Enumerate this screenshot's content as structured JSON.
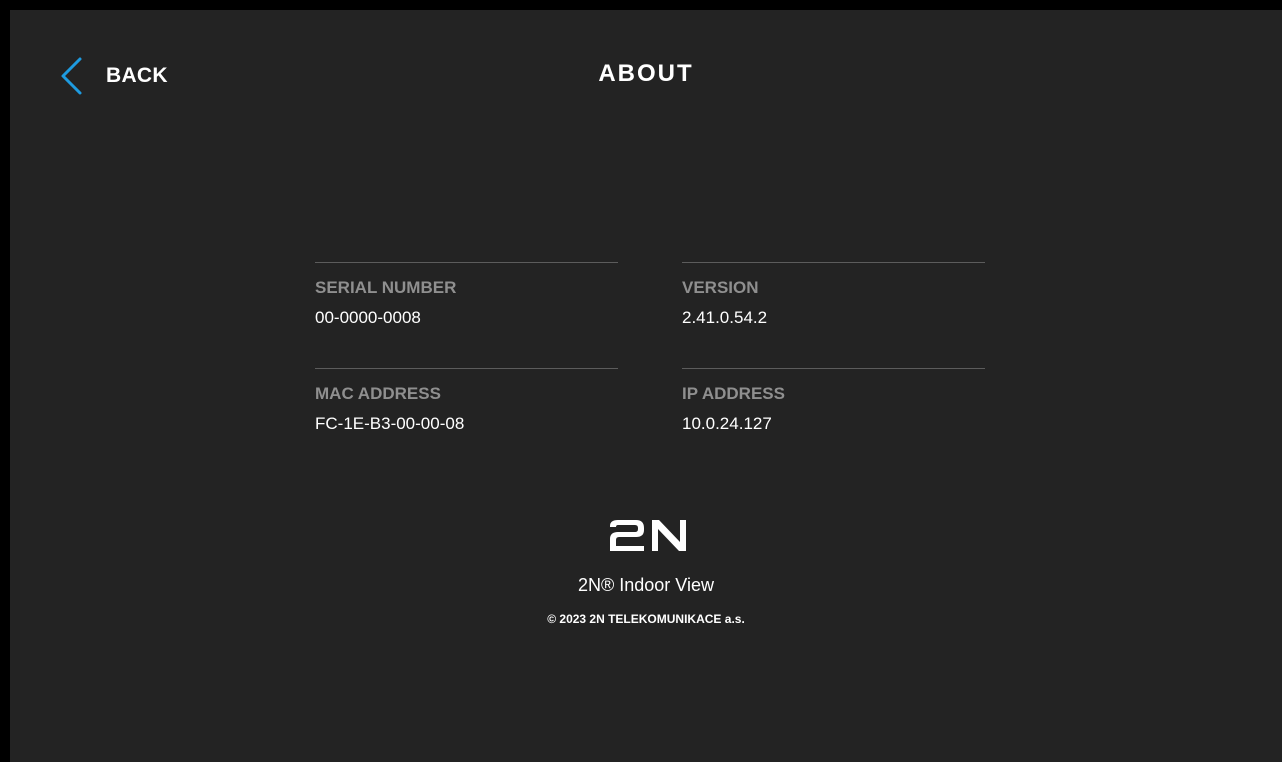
{
  "header": {
    "back_label": "BACK",
    "title": "ABOUT",
    "back_icon": "chevron-left-icon",
    "accent_color": "#1e9be0"
  },
  "info": {
    "serial": {
      "label": "SERIAL NUMBER",
      "value": "00-0000-0008"
    },
    "version": {
      "label": "VERSION",
      "value": "2.41.0.54.2"
    },
    "mac": {
      "label": "MAC ADDRESS",
      "value": "FC-1E-B3-00-00-08"
    },
    "ip": {
      "label": "IP ADDRESS",
      "value": "10.0.24.127"
    }
  },
  "branding": {
    "logo_text": "2N",
    "product_name": "2N® Indoor View",
    "copyright": "© 2023 2N TELEKOMUNIKACE a.s."
  },
  "colors": {
    "background": "#232323",
    "label": "#8f8f8f",
    "divider": "#5c5c5c",
    "text": "#ffffff"
  }
}
